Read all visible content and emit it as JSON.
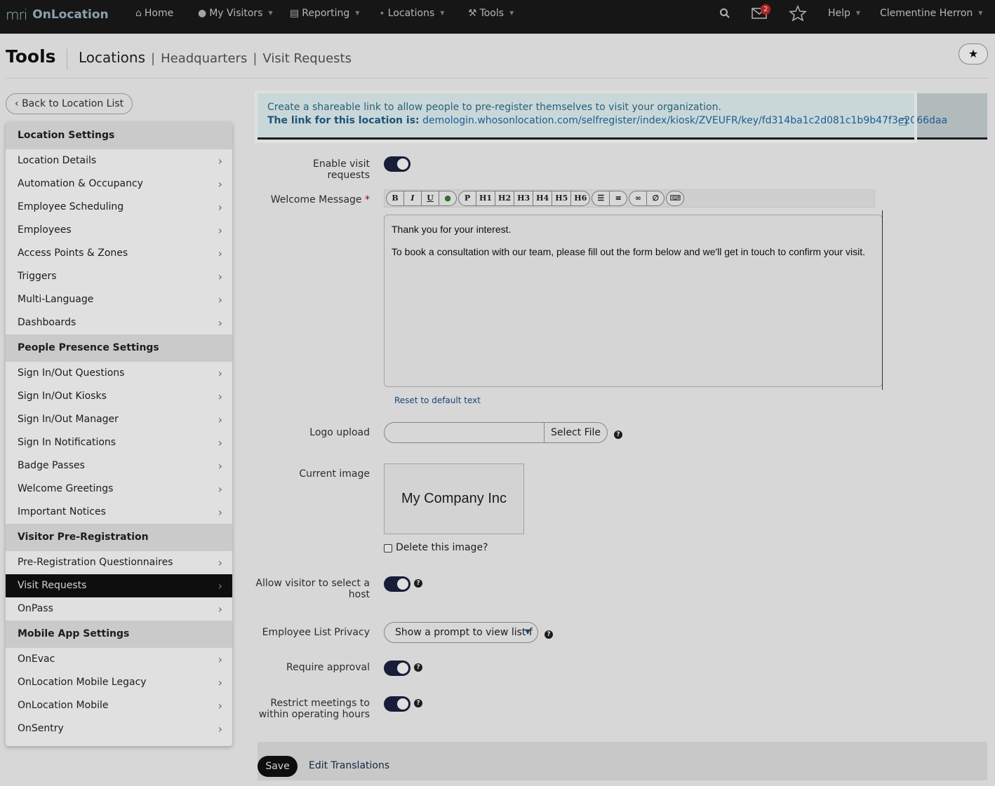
{
  "app": {
    "logo_mark": "mri",
    "name": "OnLocation"
  },
  "nav": {
    "home": "Home",
    "my_visitors": "My Visitors",
    "reporting": "Reporting",
    "locations": "Locations",
    "tools": "Tools",
    "mail_count": "2",
    "help": "Help",
    "user": "Clementine Herron"
  },
  "header": {
    "title": "Tools",
    "crumb_main": "Locations",
    "crumb_sep": "|",
    "crumb_2": "Headquarters",
    "crumb_3": "Visit Requests"
  },
  "back_button": "Back to Location List",
  "sidebar": {
    "sections": [
      {
        "heading": "Location Settings",
        "items": [
          "Location Details",
          "Automation & Occupancy",
          "Employee Scheduling",
          "Employees",
          "Access Points & Zones",
          "Triggers",
          "Multi-Language",
          "Dashboards"
        ]
      },
      {
        "heading": "People Presence Settings",
        "items": [
          "Sign In/Out Questions",
          "Sign In/Out Kiosks",
          "Sign In/Out Manager",
          "Sign In Notifications",
          "Badge Passes",
          "Welcome Greetings",
          "Important Notices"
        ]
      },
      {
        "heading": "Visitor Pre-Registration",
        "items": [
          "Pre-Registration Questionnaires",
          "Visit Requests",
          "OnPass"
        ]
      },
      {
        "heading": "Mobile App Settings",
        "items": [
          "OnEvac",
          "OnLocation Mobile Legacy",
          "OnLocation Mobile",
          "OnSentry"
        ]
      }
    ],
    "active_item": "Visit Requests"
  },
  "info": {
    "line1": "Create a shareable link to allow people to pre-register themselves to visit your organization.",
    "link_label": "The link for this location is:",
    "link_url": "demologin.whosonlocation.com/selfregister/index/kiosk/ZVEUFR/key/fd314ba1c2d081c1b9b47f3e2066daa"
  },
  "form": {
    "enable_label": "Enable visit requests",
    "enable_value": true,
    "welcome_label": "Welcome Message",
    "required_mark": "*",
    "toolbar": [
      "B",
      "I",
      "U",
      "●",
      "P",
      "H1",
      "H2",
      "H3",
      "H4",
      "H5",
      "H6",
      "☰",
      "≡",
      "∞",
      "∅",
      "⌨"
    ],
    "welcome_line1": "Thank you for your interest.",
    "welcome_line2": "To book a consultation with our team, please fill out the form below and we'll get in touch to confirm your visit.",
    "reset_link": "Reset to default text",
    "logo_label": "Logo upload",
    "logo_value": "",
    "select_file": "Select File",
    "current_image_label": "Current image",
    "current_image_text": "My Company Inc",
    "delete_image_label": "Delete this image?",
    "delete_image_checked": false,
    "allow_host_label_1": "Allow visitor to select a",
    "allow_host_label_2": "host",
    "allow_host_value": true,
    "privacy_label": "Employee List Privacy",
    "privacy_value": "Show a prompt to view list f",
    "approval_label": "Require approval",
    "approval_value": true,
    "restrict_label_1": "Restrict meetings to",
    "restrict_label_2": "within operating hours",
    "restrict_value": true,
    "help_glyph": "?"
  },
  "footer": {
    "save": "Save",
    "edit_translations": "Edit Translations"
  }
}
